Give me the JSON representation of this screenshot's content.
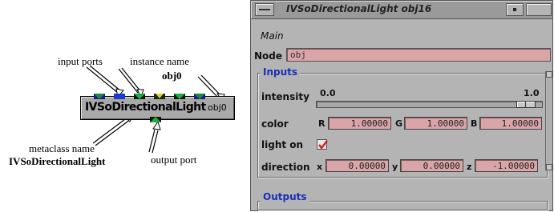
{
  "annotations": {
    "input_ports": "input ports",
    "instance_name": "instance name",
    "instance_value": "obj0",
    "metaclass_name": "metaclass name",
    "metaclass_value": "IVSoDirectionalLight",
    "output_port": "output port"
  },
  "node_icon": {
    "class_name": "IVSoDirectionalLight",
    "instance": "obj0"
  },
  "window": {
    "title": "IVSoDirectionalLight obj16",
    "menu_main": "Main",
    "node_label": "Node",
    "node_value": "obj",
    "inputs_title": "Inputs",
    "outputs_title": "Outputs",
    "intensity": {
      "label": "intensity",
      "min_label": "0.0",
      "max_label": "1.0",
      "value_fraction": 0.97
    },
    "color": {
      "label": "color",
      "r_label": "R",
      "r": "1.00000",
      "g_label": "G",
      "g": "1.00000",
      "b_label": "B",
      "b": "1.00000"
    },
    "light_on": {
      "label": "light on",
      "checked": true
    },
    "direction": {
      "label": "direction",
      "x_label": "x",
      "x": "0.00000",
      "y_label": "y",
      "y": "0.00000",
      "z_label": "z",
      "z": "-1.00000"
    }
  },
  "colors": {
    "field_bg": "#d9a5a8",
    "group_title": "#1a2fb8",
    "panel_bg": "#b4b4b4",
    "checkmark": "#d02020"
  }
}
